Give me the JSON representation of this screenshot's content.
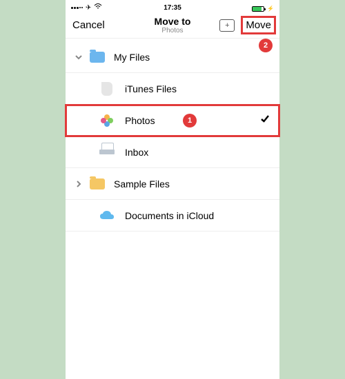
{
  "status": {
    "time": "17:35"
  },
  "nav": {
    "cancel": "Cancel",
    "title": "Move to",
    "subtitle": "Photos",
    "move": "Move"
  },
  "rows": {
    "myfiles": "My Files",
    "itunes": "iTunes Files",
    "photos": "Photos",
    "inbox": "Inbox",
    "sample": "Sample Files",
    "icloud": "Documents in iCloud"
  },
  "annotations": {
    "b1": "1",
    "b2": "2"
  }
}
